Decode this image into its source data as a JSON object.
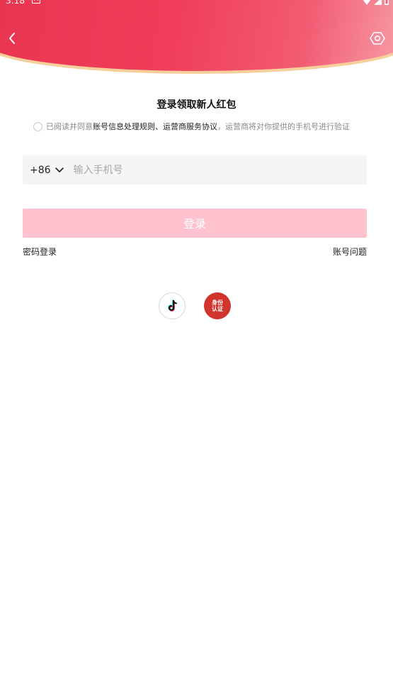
{
  "status_bar": {
    "time": "3:18",
    "notification_badge": "A",
    "icons": [
      "wifi-icon",
      "signal-icon",
      "battery-icon"
    ]
  },
  "header": {
    "back_icon": "chevron-left-icon",
    "settings_icon": "hexagon-gear-icon",
    "accent_colors": [
      "#e8344f",
      "#f25b72",
      "#f6cf9a"
    ]
  },
  "login": {
    "title": "登录领取新人红包",
    "agreement": {
      "prefix": "已阅读并同意",
      "link1": "账号信息处理规则",
      "separator": "、",
      "link2": "运营商服务协议",
      "suffix": "，运营商将对你提供的手机号进行验证"
    },
    "country_code": "+86",
    "phone_placeholder": "输入手机号",
    "phone_value": "",
    "login_button": "登录",
    "login_button_color": "#ffc2cf",
    "password_login": "密码登录",
    "account_issue": "账号问题"
  },
  "social": {
    "douyin_icon": "tiktok-icon",
    "id_auth_line1": "身份",
    "id_auth_line2": "认证"
  }
}
